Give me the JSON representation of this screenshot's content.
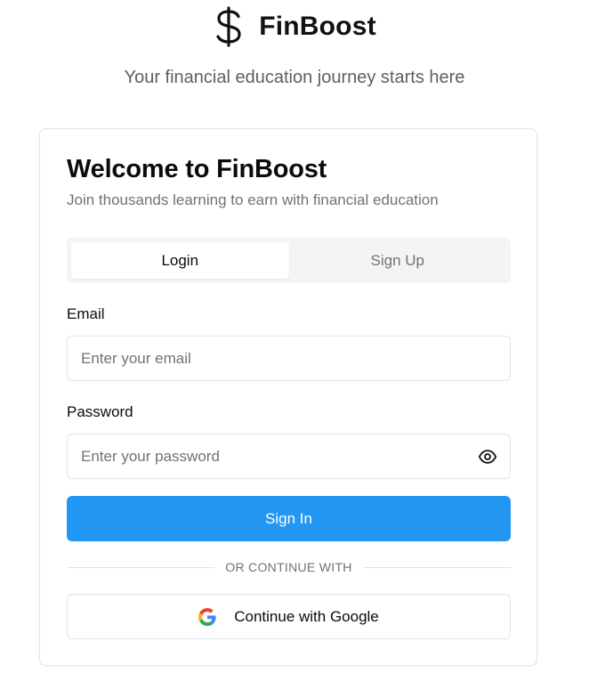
{
  "header": {
    "brand_icon": "dollar-sign-icon",
    "brand_name": "FinBoost",
    "tagline": "Your financial education journey starts here"
  },
  "card": {
    "title": "Welcome to FinBoost",
    "subtitle": "Join thousands learning to earn with financial education",
    "tabs": [
      {
        "label": "Login",
        "active": true
      },
      {
        "label": "Sign Up",
        "active": false
      }
    ],
    "email": {
      "label": "Email",
      "placeholder": "Enter your email",
      "value": ""
    },
    "password": {
      "label": "Password",
      "placeholder": "Enter your password",
      "value": "",
      "toggle_icon": "eye-icon"
    },
    "submit_label": "Sign In",
    "divider_text": "OR CONTINUE WITH",
    "google": {
      "icon": "google-icon",
      "label": "Continue with Google"
    }
  },
  "colors": {
    "primary": "#2196f3",
    "border": "#e4e4e7",
    "muted_text": "#71717a",
    "tab_bg": "#f4f4f5"
  }
}
